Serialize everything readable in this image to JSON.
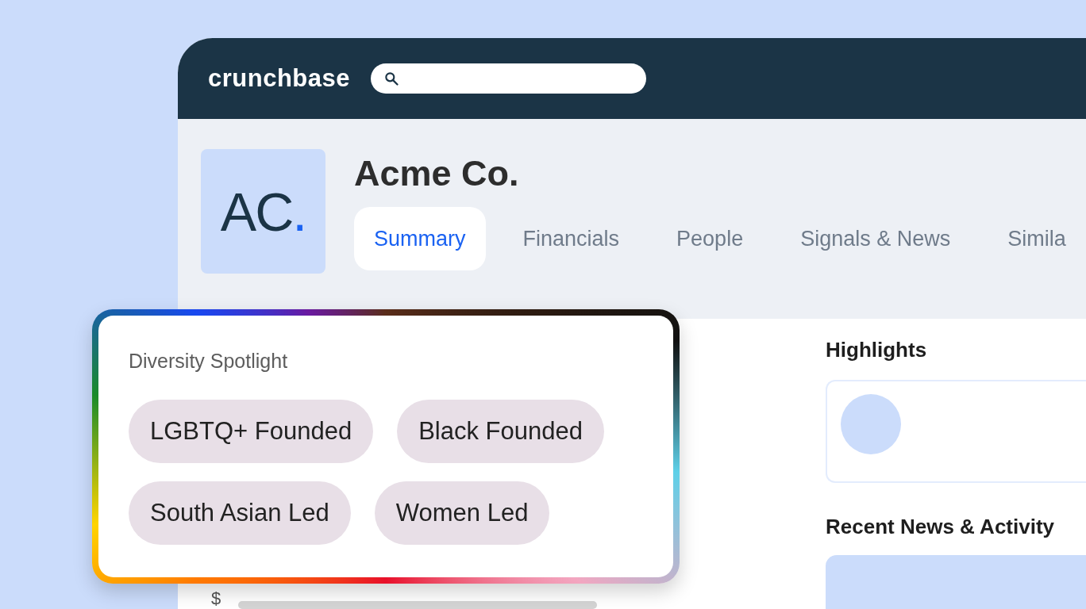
{
  "header": {
    "logo": "crunchbase"
  },
  "company": {
    "logo": {
      "letters": "AC",
      "dot": "."
    },
    "name": "Acme Co."
  },
  "tabs": [
    {
      "label": "Summary",
      "selected": true
    },
    {
      "label": "Financials",
      "selected": false
    },
    {
      "label": "People",
      "selected": false
    },
    {
      "label": "Signals & News",
      "selected": false
    },
    {
      "label": "Simila",
      "selected": false
    }
  ],
  "spotlight": {
    "title": "Diversity Spotlight",
    "tags": [
      "LGBTQ+ Founded",
      "Black Founded",
      "South Asian Led",
      "Women Led"
    ]
  },
  "left_column": {
    "currency_symbol": "$"
  },
  "highlights": {
    "title": "Highlights"
  },
  "recent_news": {
    "title": "Recent News & Activity"
  }
}
